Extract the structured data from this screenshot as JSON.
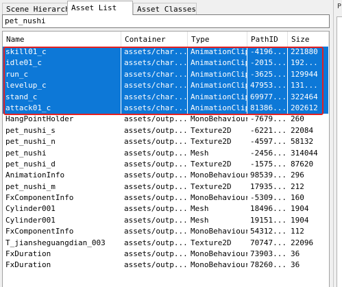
{
  "tabs": [
    {
      "label": "Scene Hierarchy",
      "active": false
    },
    {
      "label": "Asset List",
      "active": true
    },
    {
      "label": "Asset Classes",
      "active": false
    }
  ],
  "search": {
    "value": "pet_nushi"
  },
  "table": {
    "columns": [
      "Name",
      "Container",
      "Type",
      "PathID",
      "Size"
    ],
    "rows": [
      {
        "name": "skill01_c",
        "container": "assets/char...",
        "type": "AnimationClip",
        "path_id": "-4196...",
        "size": "221880",
        "selected": true
      },
      {
        "name": "idle01_c",
        "container": "assets/char...",
        "type": "AnimationClip",
        "path_id": "-2015...",
        "size": "192...",
        "selected": true
      },
      {
        "name": "run_c",
        "container": "assets/char...",
        "type": "AnimationClip",
        "path_id": "-3625...",
        "size": "129944",
        "selected": true
      },
      {
        "name": "levelup_c",
        "container": "assets/char...",
        "type": "AnimationClip",
        "path_id": "47953...",
        "size": "131...",
        "selected": true
      },
      {
        "name": "stand_c",
        "container": "assets/char...",
        "type": "AnimationClip",
        "path_id": "69977...",
        "size": "322464",
        "selected": true
      },
      {
        "name": "attack01_c",
        "container": "assets/char...",
        "type": "AnimationClip",
        "path_id": "81386...",
        "size": "202612",
        "selected": true
      },
      {
        "name": "HangPointHolder",
        "container": "assets/outp...",
        "type": "MonoBehaviour",
        "path_id": "-7679...",
        "size": "260",
        "selected": false
      },
      {
        "name": "pet_nushi_s",
        "container": "assets/outp...",
        "type": "Texture2D",
        "path_id": "-6221...",
        "size": "22084",
        "selected": false
      },
      {
        "name": "pet_nushi_n",
        "container": "assets/outp...",
        "type": "Texture2D",
        "path_id": "-4597...",
        "size": "58132",
        "selected": false
      },
      {
        "name": "pet_nushi",
        "container": "assets/outp...",
        "type": "Mesh",
        "path_id": "-2456...",
        "size": "314044",
        "selected": false
      },
      {
        "name": "pet_nushi_d",
        "container": "assets/outp...",
        "type": "Texture2D",
        "path_id": "-1575...",
        "size": "87620",
        "selected": false
      },
      {
        "name": "AnimationInfo",
        "container": "assets/outp...",
        "type": "MonoBehaviour",
        "path_id": "98539...",
        "size": "296",
        "selected": false
      },
      {
        "name": "pet_nushi_m",
        "container": "assets/outp...",
        "type": "Texture2D",
        "path_id": "17935...",
        "size": "212",
        "selected": false
      },
      {
        "name": "FxComponentInfo",
        "container": "assets/outp...",
        "type": "MonoBehaviour",
        "path_id": "-5309...",
        "size": "160",
        "selected": false
      },
      {
        "name": "Cylinder001",
        "container": "assets/outp...",
        "type": "Mesh",
        "path_id": "18496...",
        "size": "1904",
        "selected": false
      },
      {
        "name": "Cylinder001",
        "container": "assets/outp...",
        "type": "Mesh",
        "path_id": "19151...",
        "size": "1904",
        "selected": false
      },
      {
        "name": "FxComponentInfo",
        "container": "assets/outp...",
        "type": "MonoBehaviour",
        "path_id": "54312...",
        "size": "112",
        "selected": false
      },
      {
        "name": "T_jiansheguangdian_003",
        "container": "assets/outp...",
        "type": "Texture2D",
        "path_id": "70747...",
        "size": "22096",
        "selected": false
      },
      {
        "name": "FxDuration",
        "container": "assets/outp...",
        "type": "MonoBehaviour",
        "path_id": "73903...",
        "size": "36",
        "selected": false
      },
      {
        "name": "FxDuration",
        "container": "assets/outp...",
        "type": "MonoBehaviour",
        "path_id": "78260...",
        "size": "36",
        "selected": false
      }
    ]
  },
  "right_panel": {
    "label": "P"
  },
  "colors": {
    "selection": "#0d78d7",
    "highlight_box": "#e51f1f"
  }
}
